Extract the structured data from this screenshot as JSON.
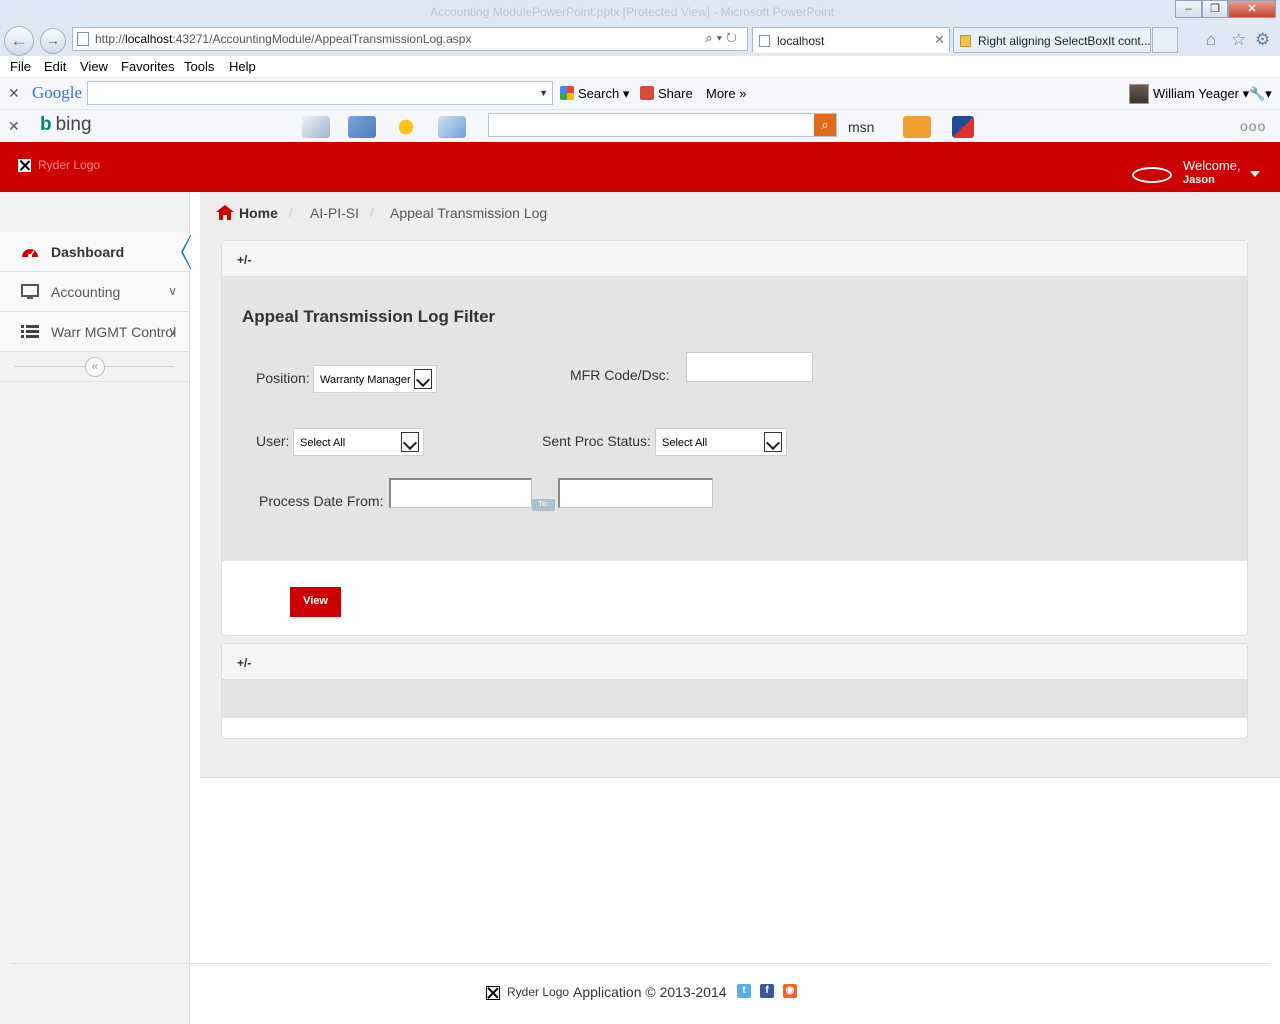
{
  "browser": {
    "window_title": "Accounting ModulePowerPoint.pptx [Protected View] - Microsoft PowerPoint",
    "address": {
      "prefix": "http://",
      "host": "localhost",
      "path": ":43271/AccountingModule/AppealTransmissionLog.aspx"
    },
    "tabs": [
      {
        "label": "localhost",
        "active": true
      },
      {
        "label": "Right aligning SelectBoxIt cont...",
        "active": false
      }
    ],
    "menu": [
      "File",
      "Edit",
      "View",
      "Favorites",
      "Tools",
      "Help"
    ],
    "google_toolbar": {
      "logo": "Google",
      "search_label": "Search",
      "share_label": "Share",
      "more_label": "More",
      "user": "William Yeager"
    },
    "bing_toolbar": {
      "logo": "bing",
      "msn": "msn"
    }
  },
  "app": {
    "logo_alt": "Ryder Logo",
    "welcome": "Welcome,",
    "user_name": "Jason",
    "brand_color": "#cc0000"
  },
  "sidebar": {
    "items": [
      {
        "label": "Dashboard",
        "icon": "dashboard-icon",
        "active": true
      },
      {
        "label": "Accounting",
        "icon": "desktop-icon",
        "active": false
      },
      {
        "label": "Warr MGMT Control",
        "icon": "list-icon",
        "active": false
      }
    ],
    "collapse_glyph": "«"
  },
  "breadcrumb": {
    "home": "Home",
    "items": [
      "AI-PI-SI",
      "Appeal Transmission Log"
    ],
    "separator": "/"
  },
  "filter_panel": {
    "toggle": "+/-",
    "title": "Appeal Transmission Log Filter",
    "position_label": "Position:",
    "position_value": "Warranty Manager",
    "mfr_label": "MFR Code/Dsc:",
    "mfr_value": "",
    "user_label": "User:",
    "user_value": "Select All",
    "sent_status_label": "Sent Proc Status:",
    "sent_status_value": "Select All",
    "process_date_label": "Process Date From:",
    "date_from": "",
    "date_to": "",
    "to_label": "To:",
    "view_button": "View"
  },
  "results_panel": {
    "toggle": "+/-"
  },
  "footer": {
    "logo_alt": "Ryder Logo",
    "copyright": "Application © 2013-2014",
    "social": [
      {
        "icon": "twitter-icon",
        "color": "#55acee"
      },
      {
        "icon": "facebook-icon",
        "color": "#3b5998"
      },
      {
        "icon": "rss-icon",
        "color": "#f26522"
      }
    ]
  }
}
